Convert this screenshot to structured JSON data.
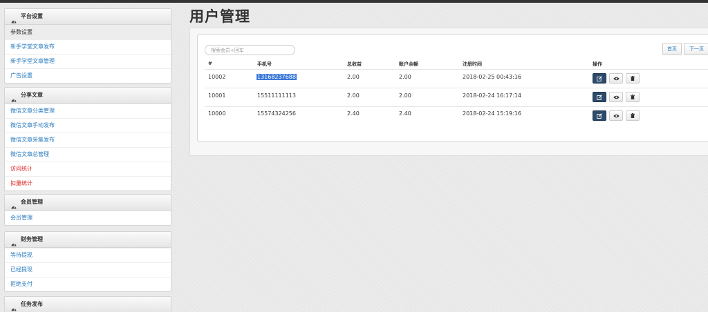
{
  "sidebar": {
    "sections": [
      {
        "title": "平台设置",
        "items": [
          {
            "label": "参数设置"
          },
          {
            "label": "新手学堂文章发布"
          },
          {
            "label": "新手学堂文章管理"
          },
          {
            "label": "广告设置"
          }
        ]
      },
      {
        "title": "分享文章",
        "items": [
          {
            "label": "微信文章分类管理"
          },
          {
            "label": "微信文章手动发布"
          },
          {
            "label": "微信文章采集发布"
          },
          {
            "label": "微信文章总管理"
          },
          {
            "label": "访问统计"
          },
          {
            "label": "扣量统计"
          }
        ]
      },
      {
        "title": "会员管理",
        "items": [
          {
            "label": "会员管理"
          }
        ]
      },
      {
        "title": "财务管理",
        "items": [
          {
            "label": "等待提现"
          },
          {
            "label": "已经提现"
          },
          {
            "label": "拒绝支付"
          }
        ]
      },
      {
        "title": "任务发布",
        "items": []
      }
    ]
  },
  "main": {
    "title": "用户管理",
    "search_placeholder": "搜索会员+回车",
    "pager": {
      "first": "首页",
      "next": "下一页"
    },
    "columns": [
      "#",
      "手机号",
      "总收益",
      "账户余额",
      "注册时间",
      "操作"
    ],
    "rows": [
      {
        "id": "10002",
        "phone": "13168237688",
        "total": "2.00",
        "balance": "2.00",
        "time": "2018-02-25 00:43:16"
      },
      {
        "id": "10001",
        "phone": "15511111113",
        "total": "2.00",
        "balance": "2.00",
        "time": "2018-02-24 16:17:14"
      },
      {
        "id": "10000",
        "phone": "15574324256",
        "total": "2.40",
        "balance": "2.40",
        "time": "2018-02-24 15:19:16"
      }
    ]
  },
  "icons": {
    "section": "dashboard-icon",
    "edit": "edit-icon",
    "view": "eye-icon",
    "delete": "trash-icon"
  },
  "colors": {
    "link": "#2a7bbf",
    "alert": "#e02020",
    "edit_button": "#2d4a6a",
    "selection": "#3b78d8"
  }
}
